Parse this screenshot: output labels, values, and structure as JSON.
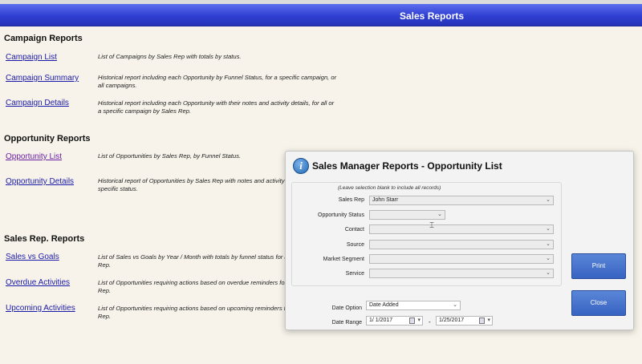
{
  "window": {
    "title": "Sales Reports"
  },
  "sections": {
    "campaign": "Campaign Reports",
    "opportunity": "Opportunity Reports",
    "salesrep": "Sales Rep. Reports"
  },
  "reports": [
    {
      "label": "Campaign List",
      "desc": "List of Campaigns by Sales Rep with totals by status."
    },
    {
      "label": "Campaign Summary",
      "desc": "Historical report including each Opportunity by Funnel Status, for a specific campaign, or all campaigns."
    },
    {
      "label": "Campaign Details",
      "desc": "Historical report including each Opportunity with their notes and activity details, for all or a specific campaign by Sales Rep."
    },
    {
      "label": "Opportunity List",
      "desc": "List of Opportunities by Sales Rep, by Funnel Status."
    },
    {
      "label": "Opportunity Details",
      "desc": "Historical report of Opportunities by Sales Rep with notes and activity details, for a specific status."
    },
    {
      "label": "Sales vs Goals",
      "desc": "List of Sales vs Goals by Year / Month with totals by funnel status for a specific Sales Rep."
    },
    {
      "label": "Overdue Activities",
      "desc": "List of Opportunities requiring actions based on overdue reminders for a specific Sales Rep."
    },
    {
      "label": "Upcoming Activities",
      "desc": "List of Opportunities requiring actions based on upcoming reminders for a specific Sales Rep."
    }
  ],
  "dialog": {
    "title": "Sales Manager Reports - Opportunity List",
    "hint": "(Leave selection blank to include all records)",
    "fields": {
      "sales_rep": {
        "label": "Sales Rep",
        "value": "John Starr"
      },
      "opportunity_status": {
        "label": "Opportunity Status",
        "value": ""
      },
      "contact": {
        "label": "Contact",
        "value": ""
      },
      "source": {
        "label": "Source",
        "value": ""
      },
      "market_segment": {
        "label": "Market Segment",
        "value": ""
      },
      "service": {
        "label": "Service",
        "value": ""
      }
    },
    "date_option": {
      "label": "Date Option",
      "value": "Date Added"
    },
    "date_range": {
      "label": "Date Range",
      "from": "1/ 1/2017",
      "separator": "-",
      "to": "1/25/2017"
    },
    "print_label": "Print",
    "close_label": "Close"
  }
}
